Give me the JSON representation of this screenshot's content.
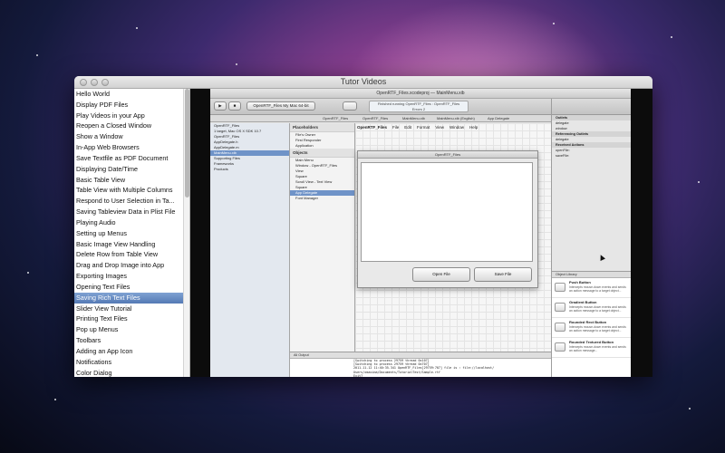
{
  "window": {
    "title": "Tutor Videos"
  },
  "sidebar": {
    "items": [
      "Hello World",
      "Display PDF Files",
      "Play Videos in your App",
      "Reopen a Closed Window",
      "Show a Window",
      "In-App Web Browsers",
      "Save Textfile as PDF Document",
      "Displaying Date/Time",
      "Basic Table View",
      "Table View with Multiple Columns",
      "Respond to User Selection in Ta...",
      "Saving Tableview Data in Plist File",
      "Playing Audio",
      "Setting up Menus",
      "Basic Image View Handling",
      "Delete Row from Table View",
      "Drag and Drop Image into App",
      "Exporting Images",
      "Opening Text Files",
      "Saving Rich Text Files",
      "Slider View Tutorial",
      "Printing Text Files",
      "Pop up Menus",
      "Toolbars",
      "Adding an App Icon",
      "Notifications",
      "Color Dialog"
    ],
    "selected_index": 19
  },
  "video": {
    "xcode_title": "OpenRTF_Files.xcodeproj — MainMenu.xib",
    "run_label": "Run",
    "stop_label": "Stop",
    "scheme_label": "OpenRTF_Files  My Mac 64-bit",
    "status_line1": "Finished running OpenRTF_Files : OpenRTF_Files",
    "status_line2": "Errors 2",
    "breadcrumbs": [
      "OpenRTF_Files",
      "OpenRTF_Files",
      "MainMenu.xib",
      "MainMenu.xib (English)",
      "App Delegate"
    ],
    "navigator": [
      "OpenRTF_Files",
      "1 target, Mac OS X SDK 10.7",
      "OpenRTF_Files",
      "AppDelegate.h",
      "AppDelegate.m",
      "MainMenu.xib",
      "Supporting Files",
      "Frameworks",
      "Products"
    ],
    "navigator_selected": 5,
    "placeholders_label": "Placeholders",
    "placeholders": [
      "File's Owner",
      "First Responder",
      "Application"
    ],
    "objects_label": "Objects",
    "objects": [
      "Main Menu",
      "Window - OpenRTF_Files",
      "View",
      "Square",
      "Scroll View - Text View",
      "Square",
      "App Delegate",
      "Font Manager"
    ],
    "objects_selected": 6,
    "menu_bar": [
      "OpenRTF_Files",
      "File",
      "Edit",
      "Format",
      "View",
      "Window",
      "Help"
    ],
    "mock_window_title": "OpenRTF_Files",
    "open_button": "Open File",
    "save_button": "Save File",
    "console_header": "All Output",
    "console_lines": [
      "[Switching to process 29759 thread 0x107]",
      "[Switching to process 29759 thread 0x707]",
      "2011-11-12 11:40:35.341 OpenRTF_Files[29759:707] file is : file://localhost/",
      "Users/xmaxima/Documents/TutorialTest/Sample.rtf",
      "Exit?",
      "Exit?"
    ],
    "inspector_rows": [
      "Outlets",
      "delegate",
      "window",
      "Referencing Outlets",
      "delegate",
      "Received Actions",
      "openFile:",
      "saveFile:"
    ],
    "library_selector": "Object Library",
    "library_items": [
      {
        "name": "Push Button",
        "desc": "Intercepts mouse-down events and sends an action message to a target object..."
      },
      {
        "name": "Gradient Button",
        "desc": "Intercepts mouse-down events and sends an action message to a target object..."
      },
      {
        "name": "Rounded Rect Button",
        "desc": "Intercepts mouse-down events and sends an action message to a target object..."
      },
      {
        "name": "Rounded Textured Button",
        "desc": "Intercepts mouse-down events and sends an action message..."
      }
    ]
  }
}
